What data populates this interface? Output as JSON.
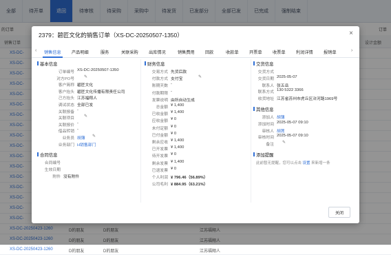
{
  "background": {
    "tabs": [
      "全部",
      "待开单",
      "退回",
      "待审核",
      "待采购",
      "采购中",
      "待发货",
      "已发部分",
      "全部已发",
      "已完成",
      "强制结束"
    ],
    "toolbar_left": "的订单",
    "toolbar_right": "订单",
    "header_left": "销售订单",
    "header_right": "设计金额",
    "rows": [
      {
        "code": "XS-DC-",
        "extra": ""
      },
      {
        "code": "XS-DC-",
        "extra": ""
      },
      {
        "code": "XS-DC-",
        "extra": ""
      },
      {
        "code": "XS-DC-",
        "extra": ""
      },
      {
        "code": "XS-DC-",
        "extra": ""
      },
      {
        "code": "XS-DC-",
        "extra": ""
      },
      {
        "code": "XS-DC-",
        "extra": ""
      },
      {
        "code": "XS-DC-",
        "extra": ""
      },
      {
        "code": "XS-DC-",
        "extra": ""
      },
      {
        "code": "XS-DC-",
        "extra": ""
      },
      {
        "code": "XS-DC-",
        "extra": ""
      },
      {
        "code": "XS-DC-",
        "extra": ""
      },
      {
        "code": "XS-DC-",
        "extra": ""
      },
      {
        "code": "XS-DC-",
        "extra": ""
      },
      {
        "code": "XS-DC-",
        "extra": ""
      },
      {
        "code": "XS-DC-",
        "extra": ""
      },
      {
        "code": "XS-DC-",
        "extra": ""
      },
      {
        "code": "XS-DC-20250423-1260",
        "extra": "D的朋友"
      }
    ],
    "row_cols": {
      "a": "D的朋友",
      "b": "D的朋友",
      "c": "江苏福翔人"
    },
    "last_rows": [
      {
        "code": "XS-DC-20250423-1260",
        "b": "D的朋友",
        "c": "D的朋友",
        "d": "江苏福翔人"
      },
      {
        "code": "XS-DC-20250423-1260",
        "b": "D的朋友",
        "c": "D的朋友",
        "d": "江苏福翔人"
      }
    ]
  },
  "modal": {
    "title": "2379：碧匠文化的销售订单（XS-DC-20250507-1350）",
    "close_icon": "×",
    "tabs": [
      "销售信息",
      "产品明细",
      "服务",
      "关联采购",
      "出库情况",
      "销售费用",
      "回款",
      "收款单",
      "开票单",
      "收票单",
      "利润详情",
      "报销单"
    ],
    "basic": {
      "title": "基本信息",
      "fields": [
        {
          "label": "订单编号",
          "value": "XS-DC-20250507-1350"
        },
        {
          "label": "对方PO号",
          "value": ""
        },
        {
          "label": "客户简称",
          "value": "碧匠文化"
        },
        {
          "label": "客户抬头",
          "value": "碧匠文化传播有限责任公司"
        },
        {
          "label": "己方抬头",
          "value": "江苏福翔人"
        },
        {
          "label": "调试状态",
          "value": "全部已发"
        },
        {
          "label": "关联报备",
          "value": "-"
        },
        {
          "label": "关联项目",
          "value": ""
        },
        {
          "label": "关联报价",
          "value": "-"
        },
        {
          "label": "借品转销",
          "value": "-"
        },
        {
          "label": "业务员",
          "value": "胡薄"
        },
        {
          "label": "业务部门",
          "value": "H销售部门"
        }
      ]
    },
    "contract": {
      "title": "合同信息",
      "fields": [
        {
          "label": "合同编号",
          "value": ""
        },
        {
          "label": "生效日期",
          "value": ""
        },
        {
          "label": "附件",
          "value": "没有附件"
        }
      ]
    },
    "finance": {
      "title": "财务信息",
      "fields": [
        {
          "label": "交易方式",
          "value": "先货后款"
        },
        {
          "label": "付款方式",
          "value": "支付宝"
        },
        {
          "label": "账期天数",
          "value": "-"
        },
        {
          "label": "付款期限",
          "value": "-"
        },
        {
          "label": "发票说明",
          "value": "由所自动生成"
        },
        {
          "label": "总金额",
          "value": "¥ 1,400"
        },
        {
          "label": "已收金额",
          "value": "¥ 1,400"
        },
        {
          "label": "应收金额",
          "value": "¥ 0"
        },
        {
          "label": "未付定额",
          "value": "¥ 0"
        },
        {
          "label": "已付金额",
          "value": "¥ 0"
        },
        {
          "label": "剩余应收",
          "value": "¥ 1,400"
        },
        {
          "label": "已开发票",
          "value": "¥ 1,400"
        },
        {
          "label": "待开发票",
          "value": "¥ 0"
        },
        {
          "label": "剩余发票",
          "value": "¥ 1,400"
        },
        {
          "label": "已退发票",
          "value": "¥ 0"
        },
        {
          "label": "个人利润",
          "value": "¥ 796.46（56.89%）"
        },
        {
          "label": "公司毛利",
          "value": "¥ 884.95（63.21%）"
        }
      ]
    },
    "trade": {
      "title": "交货信息",
      "fields": [
        {
          "label": "交货方式",
          "value": ""
        },
        {
          "label": "交货日期",
          "value": "2025-05-07"
        },
        {
          "label": "联系人",
          "value": "张五岳"
        },
        {
          "label": "联系方式",
          "value": "130 5322 3366"
        },
        {
          "label": "收货地址",
          "value": "江苏省苏州市虎丘区浒河路1969号"
        }
      ]
    },
    "other": {
      "title": "其他信息",
      "fields": [
        {
          "label": "添加人",
          "value": "胡薄"
        },
        {
          "label": "添加时间",
          "value": "2025-05-07 09:10"
        },
        {
          "label": "审核人",
          "value": "胡莲"
        },
        {
          "label": "审核时间",
          "value": "2025-05-07 09:10"
        },
        {
          "label": "备注",
          "value": ""
        }
      ]
    },
    "reminder": {
      "title": "添加提醒",
      "text": "此前暂无提醒，您可以点击",
      "link": "设置",
      "text2": "来新增一条"
    },
    "close_button": "关闭"
  }
}
